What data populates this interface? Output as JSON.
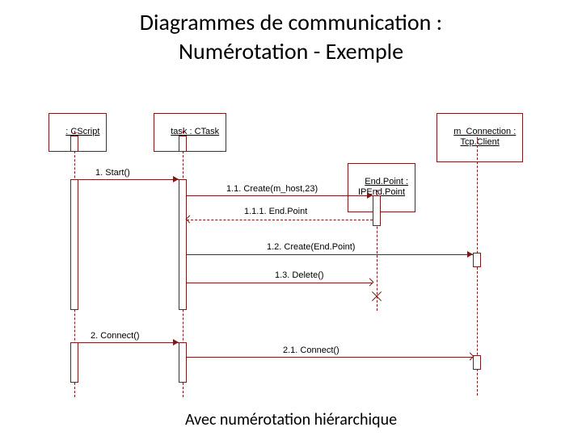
{
  "title_line1": "Diagrammes de communication :",
  "title_line2": "Numérotation - Exemple",
  "caption": "Avec numérotation hiérarchique",
  "participants": {
    "cscript": ": CScript",
    "ctask": "task : CTask",
    "endpoint": "End.Point :\nIPEnd.Point",
    "tcpclient": "m_Connection :\nTcp.Client"
  },
  "messages": {
    "m1": "1. Start()",
    "m11": "1.1. Create(m_host,23)",
    "m111": "1.1.1. End.Point",
    "m12": "1.2. Create(End.Point)",
    "m13": "1.3. Delete()",
    "m2": "2. Connect()",
    "m21": "2.1. Connect()"
  }
}
